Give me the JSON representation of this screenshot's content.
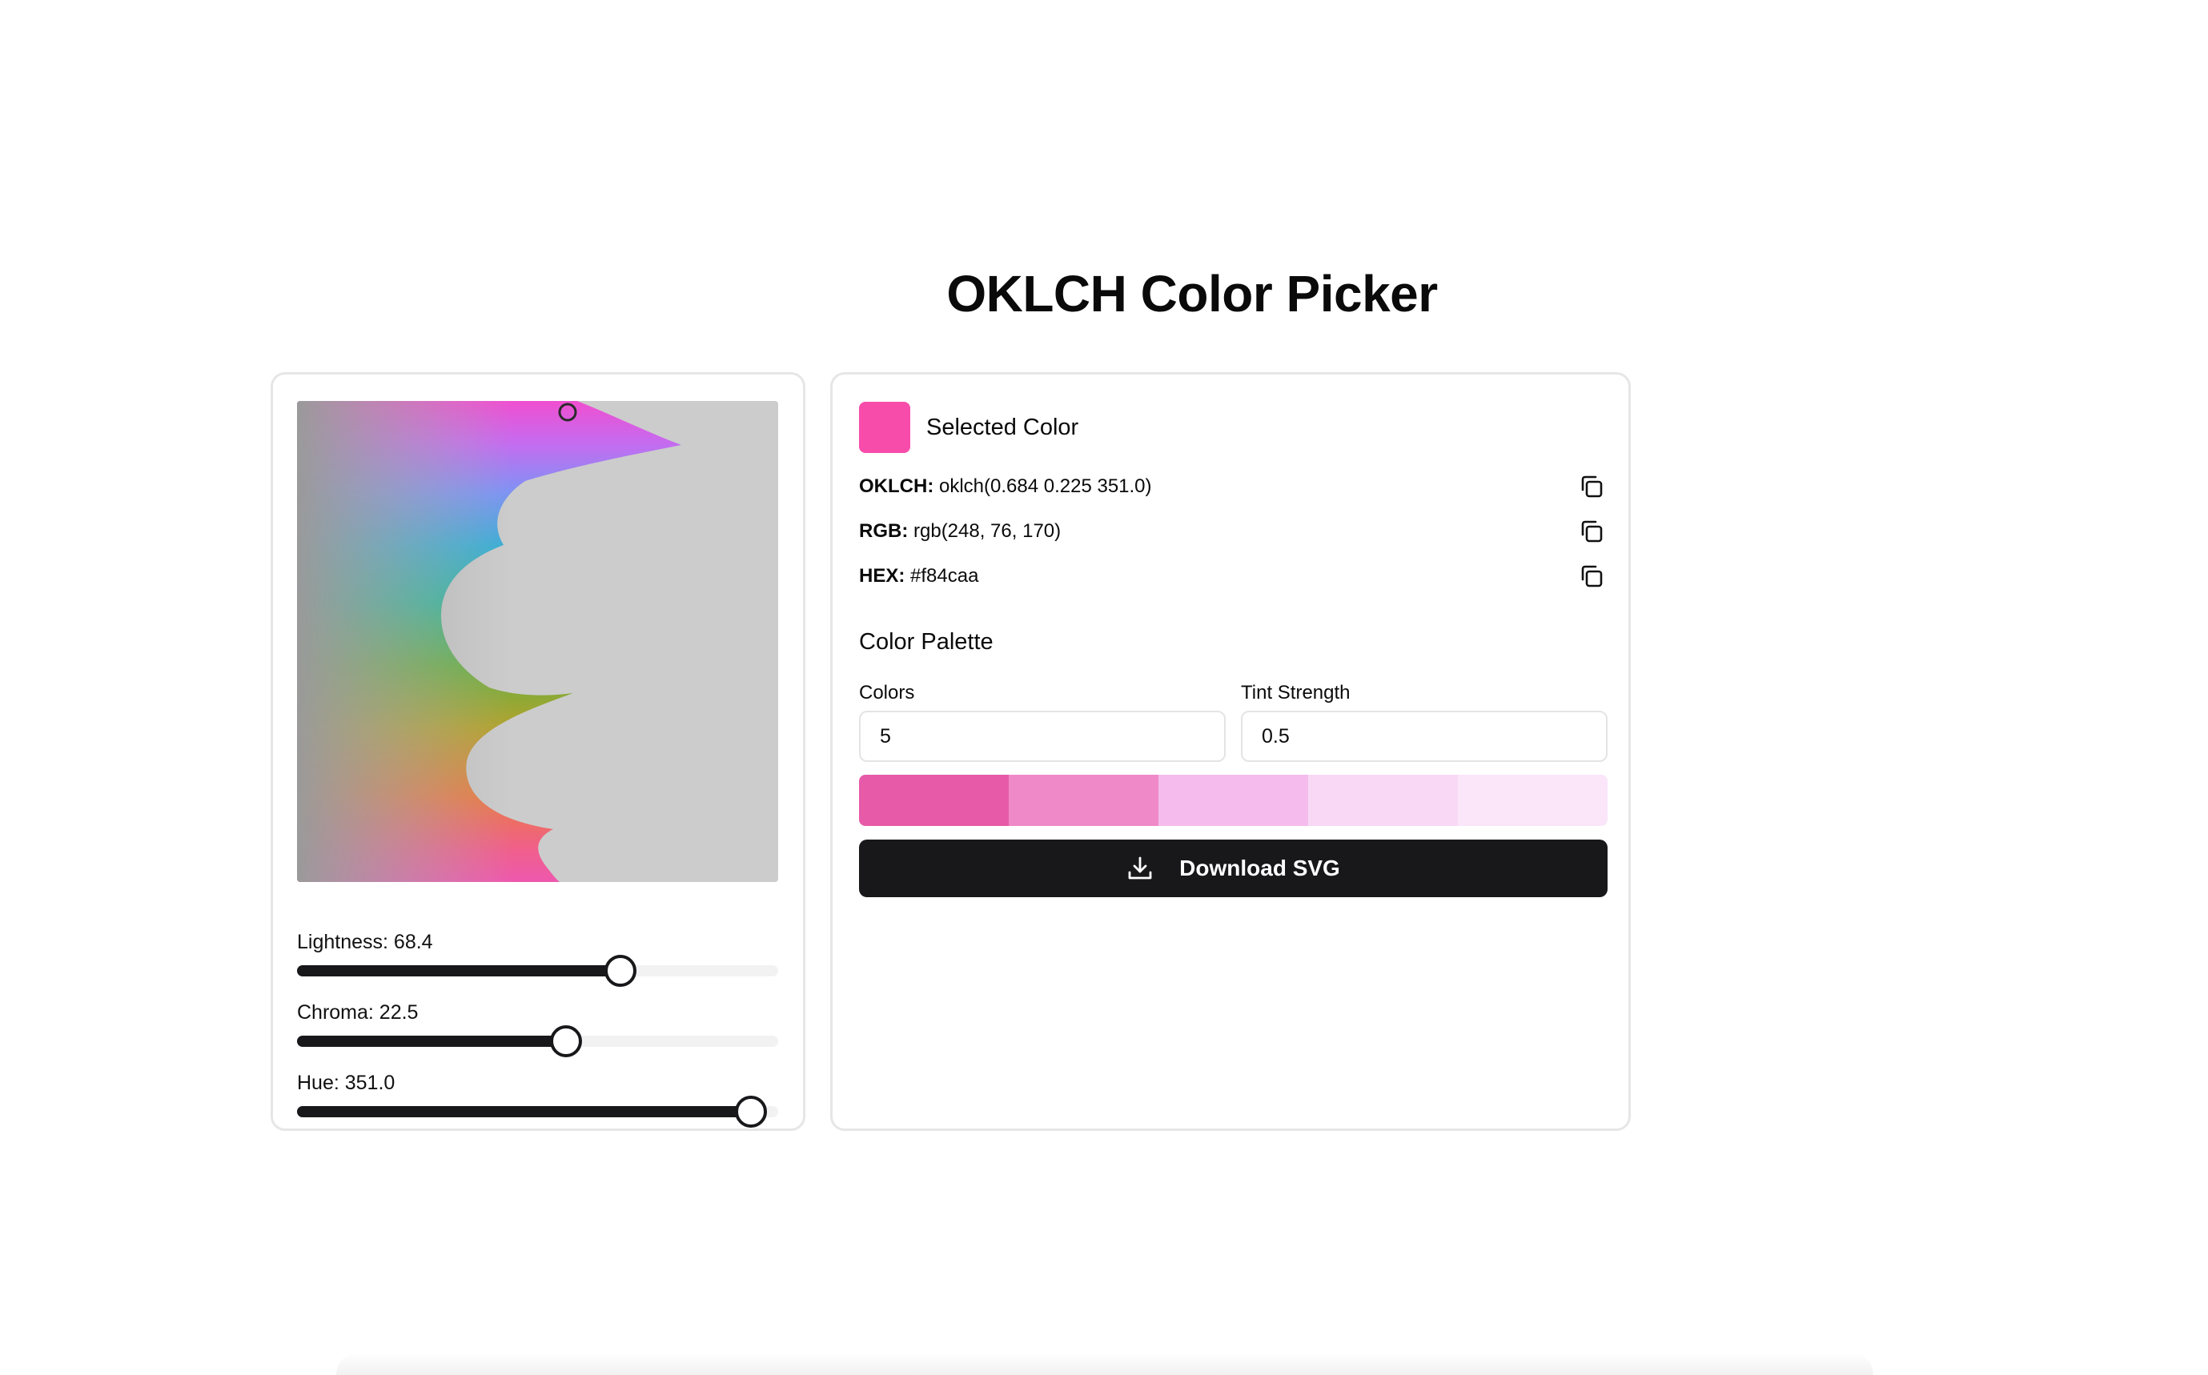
{
  "title": "OKLCH Color Picker",
  "colors": {
    "selected": "#f84caa",
    "plane_background": "#cccccc",
    "button_bg": "#18181b",
    "palette": [
      "#e75aa8",
      "#ef89c8",
      "#f4bbec",
      "#f9d8f6",
      "#fae5f9"
    ]
  },
  "sliders": [
    {
      "label": "Lightness: 68.4",
      "value": 68.4,
      "max": 100
    },
    {
      "label": "Chroma: 22.5",
      "value": 22.5,
      "max": 40
    },
    {
      "label": "Hue: 351.0",
      "value": 351.0,
      "max": 360
    }
  ],
  "selected": {
    "label": "Selected Color",
    "oklch_key": "OKLCH:",
    "oklch_value": "oklch(0.684 0.225 351.0)",
    "rgb_key": "RGB:",
    "rgb_value": "rgb(248, 76, 170)",
    "hex_key": "HEX:",
    "hex_value": "#f84caa",
    "copy_icon": "copy-icon"
  },
  "palette_section": {
    "title": "Color Palette",
    "colors_label": "Colors",
    "colors_value": "5",
    "tint_label": "Tint Strength",
    "tint_value": "0.5"
  },
  "download": {
    "label": "Download SVG",
    "icon": "download-icon"
  }
}
